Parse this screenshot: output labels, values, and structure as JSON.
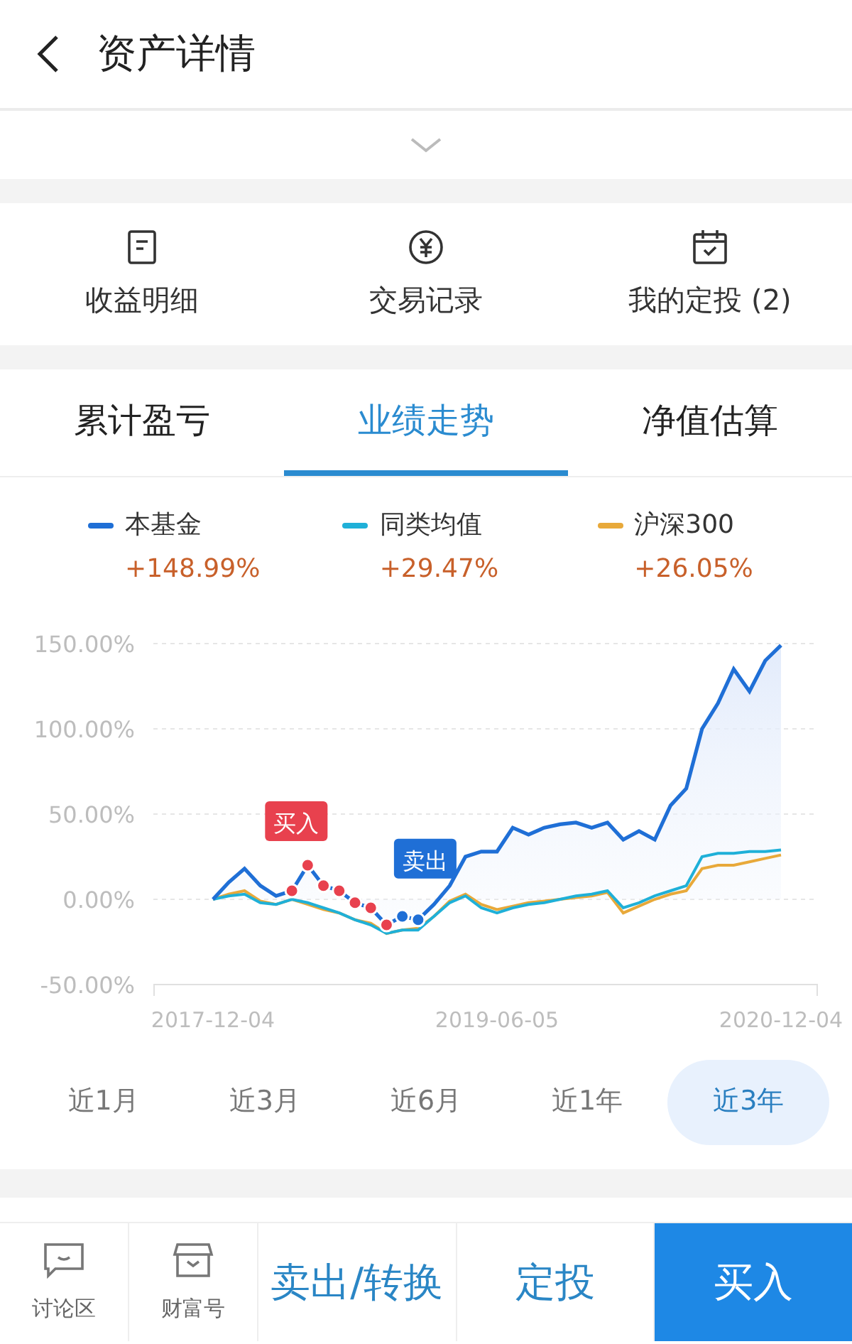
{
  "header": {
    "title": "资产详情"
  },
  "shortcuts": [
    {
      "label": "收益明细",
      "kind": "document"
    },
    {
      "label": "交易记录",
      "kind": "yen"
    },
    {
      "label": "我的定投 (2)",
      "kind": "calendar"
    }
  ],
  "tabs": [
    {
      "label": "累计盈亏",
      "selected": false
    },
    {
      "label": "业绩走势",
      "selected": true
    },
    {
      "label": "净值估算",
      "selected": false
    }
  ],
  "returns": [
    {
      "change": "+148.99%"
    },
    {
      "change": "+29.47%"
    },
    {
      "change": "+26.05%"
    }
  ],
  "chart_data": {
    "type": "line",
    "categories": [
      "2017-12-04",
      null,
      null,
      null,
      null,
      null,
      null,
      null,
      null,
      null,
      null,
      null,
      null,
      null,
      null,
      null,
      null,
      null,
      "2019-06-05",
      null,
      null,
      null,
      null,
      null,
      null,
      null,
      null,
      null,
      null,
      null,
      null,
      null,
      null,
      null,
      null,
      null,
      "2020-12-04"
    ],
    "series": [
      {
        "name": "本基金",
        "color": "#1f6fd6",
        "type": "area",
        "values": [
          0,
          10,
          18,
          8,
          2,
          5,
          20,
          8,
          5,
          -2,
          -5,
          -15,
          -10,
          -12,
          -3,
          8,
          25,
          28,
          28,
          42,
          38,
          42,
          44,
          45,
          42,
          45,
          35,
          40,
          35,
          55,
          65,
          100,
          115,
          135,
          122,
          140,
          149
        ]
      },
      {
        "name": "同类均值",
        "color": "#1fb0d8",
        "values": [
          0,
          2,
          3,
          -2,
          -3,
          0,
          -2,
          -5,
          -8,
          -12,
          -15,
          -20,
          -18,
          -18,
          -10,
          -2,
          2,
          -5,
          -8,
          -5,
          -3,
          -2,
          0,
          2,
          3,
          5,
          -5,
          -2,
          2,
          5,
          8,
          25,
          27,
          27,
          28,
          28,
          29
        ]
      },
      {
        "name": "沪深300",
        "color": "#e8a93a",
        "values": [
          0,
          3,
          5,
          -1,
          -3,
          0,
          -3,
          -6,
          -8,
          -12,
          -14,
          -20,
          -18,
          -17,
          -10,
          -1,
          3,
          -3,
          -6,
          -4,
          -2,
          -1,
          0,
          1,
          2,
          4,
          -8,
          -4,
          0,
          3,
          5,
          18,
          20,
          20,
          22,
          24,
          26
        ]
      }
    ],
    "ylim": [
      -50,
      150
    ],
    "grid": true,
    "yticks": [
      {
        "value": 150,
        "label": "150.00%"
      },
      {
        "value": 100,
        "label": "100.00%"
      },
      {
        "value": 50,
        "label": "50.00%"
      },
      {
        "value": 0,
        "label": "0.00%"
      },
      {
        "value": -50,
        "label": "-50.00%"
      }
    ],
    "annotations": [
      {
        "text": "买入",
        "y": 20
      },
      {
        "text": "卖出",
        "y": -12
      }
    ]
  },
  "periods": [
    {
      "label": "近1月",
      "selected": false
    },
    {
      "label": "近3月",
      "selected": false
    },
    {
      "label": "近6月",
      "selected": false
    },
    {
      "label": "近1年",
      "selected": false
    },
    {
      "label": "近3年",
      "selected": true
    }
  ],
  "bottom_bar": {
    "tools": [
      {
        "label": "讨论区",
        "kind": "chat"
      },
      {
        "label": "财富号",
        "kind": "shop"
      }
    ],
    "actions": [
      {
        "label": "卖出/转换",
        "kind": "secondary"
      },
      {
        "label": "定投",
        "kind": "secondary"
      },
      {
        "label": "买入",
        "kind": "primary"
      }
    ]
  }
}
